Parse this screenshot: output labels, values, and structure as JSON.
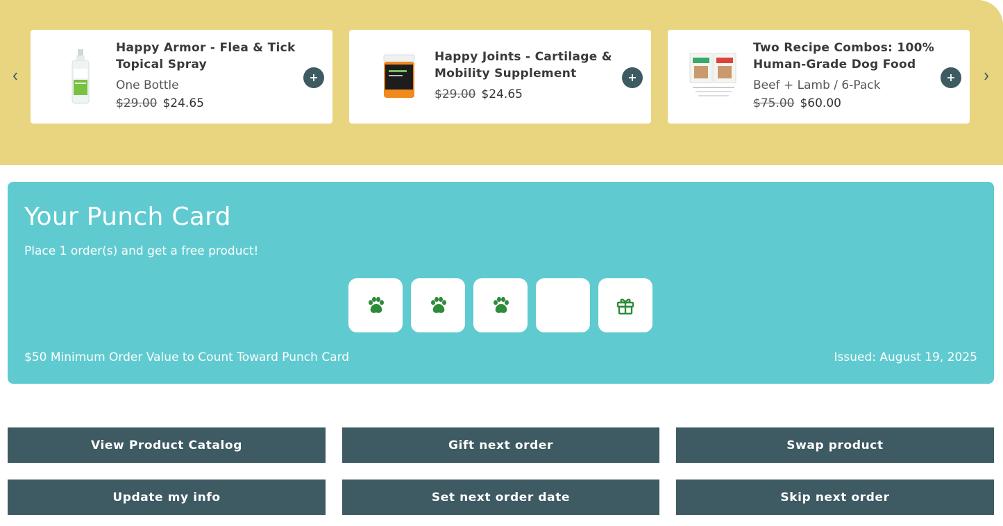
{
  "carousel": {
    "prev_icon": "chevron-left-icon",
    "next_icon": "chevron-right-icon",
    "background": "#e9d47f",
    "products": [
      {
        "title": "Happy Armor - Flea & Tick Topical Spray",
        "variant": "One Bottle",
        "old_price": "$29.00",
        "price": "$24.65",
        "image": "spray-bottle-image",
        "add_icon": "plus-icon"
      },
      {
        "title": "Happy Joints - Cartilage & Mobility Supplement",
        "variant": "",
        "old_price": "$29.00",
        "price": "$24.65",
        "image": "supplement-jar-image",
        "add_icon": "plus-icon"
      },
      {
        "title": "Two Recipe Combos: 100% Human-Grade Dog Food",
        "variant": "Beef + Lamb / 6-Pack",
        "old_price": "$75.00",
        "price": "$60.00",
        "image": "dog-food-packs-image",
        "add_icon": "plus-icon"
      }
    ]
  },
  "punch_card": {
    "title": "Your Punch Card",
    "subtitle": "Place 1 order(s) and get a free product!",
    "slots": [
      "paw-icon",
      "paw-icon",
      "paw-icon",
      "empty",
      "gift-icon"
    ],
    "note": "$50 Minimum Order Value to Count Toward Punch Card",
    "issued": "Issued: August 19, 2025",
    "background": "#5fcbd1",
    "icon_color": "#2e8b3a"
  },
  "actions": {
    "view_catalog": "View Product Catalog",
    "gift_next": "Gift next order",
    "swap_product": "Swap product",
    "update_info": "Update my info",
    "set_date": "Set next order date",
    "skip_next": "Skip next order",
    "button_color": "#3e5a63"
  }
}
